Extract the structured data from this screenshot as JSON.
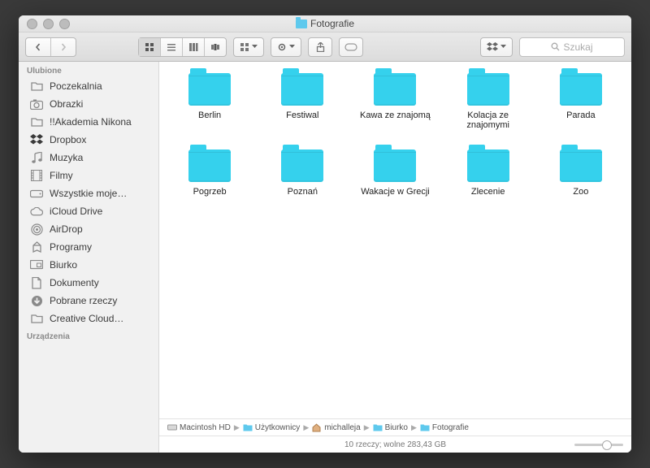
{
  "window": {
    "title": "Fotografie"
  },
  "toolbar": {
    "search_placeholder": "Szukaj"
  },
  "sidebar": {
    "favorites_heading": "Ulubione",
    "devices_heading": "Urządzenia",
    "items": [
      {
        "label": "Poczekalnia",
        "icon": "folder"
      },
      {
        "label": "Obrazki",
        "icon": "camera"
      },
      {
        "label": "!!Akademia Nikona",
        "icon": "folder"
      },
      {
        "label": "Dropbox",
        "icon": "dropbox"
      },
      {
        "label": "Muzyka",
        "icon": "music"
      },
      {
        "label": "Filmy",
        "icon": "film"
      },
      {
        "label": "Wszystkie moje…",
        "icon": "disk"
      },
      {
        "label": "iCloud Drive",
        "icon": "cloud"
      },
      {
        "label": "AirDrop",
        "icon": "airdrop"
      },
      {
        "label": "Programy",
        "icon": "apps"
      },
      {
        "label": "Biurko",
        "icon": "desktop"
      },
      {
        "label": "Dokumenty",
        "icon": "doc"
      },
      {
        "label": "Pobrane rzeczy",
        "icon": "download"
      },
      {
        "label": "Creative Cloud…",
        "icon": "folder"
      }
    ]
  },
  "folders": [
    {
      "name": "Berlin"
    },
    {
      "name": "Festiwal"
    },
    {
      "name": "Kawa ze znajomą"
    },
    {
      "name": "Kolacja ze znajomymi"
    },
    {
      "name": "Parada"
    },
    {
      "name": "Pogrzeb"
    },
    {
      "name": "Poznań"
    },
    {
      "name": "Wakacje w Grecji"
    },
    {
      "name": "Zlecenie"
    },
    {
      "name": "Zoo"
    }
  ],
  "path": [
    {
      "label": "Macintosh HD",
      "icon": "hd"
    },
    {
      "label": "Użytkownicy",
      "icon": "folder"
    },
    {
      "label": "michalleja",
      "icon": "home"
    },
    {
      "label": "Biurko",
      "icon": "folder"
    },
    {
      "label": "Fotografie",
      "icon": "folder"
    }
  ],
  "status": {
    "text": "10 rzeczy; wolne 283,43 GB"
  }
}
